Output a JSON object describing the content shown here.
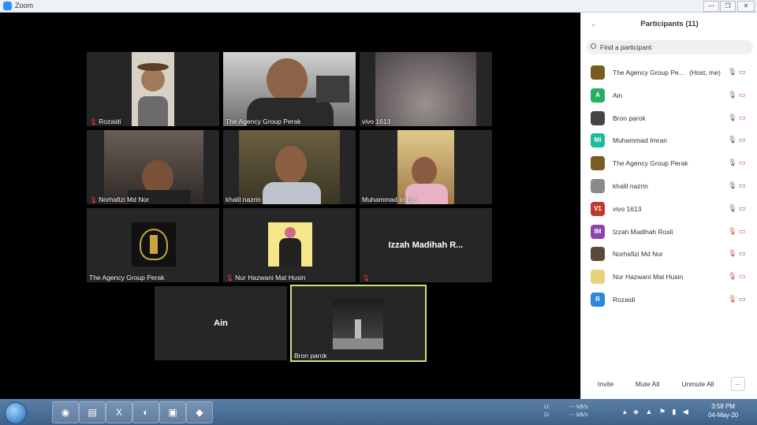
{
  "window": {
    "title": "Zoom",
    "min": "—",
    "max": "❐",
    "close": "✕"
  },
  "tiles": [
    {
      "name": "Rozaidi",
      "muted": true,
      "bg": "#2a2a2a",
      "content": "video"
    },
    {
      "name": "The Agency Group Perak",
      "muted": false,
      "bg": "#3a3a3a",
      "content": "video"
    },
    {
      "name": "vivo 1613",
      "muted": false,
      "bg": "#4a4444",
      "content": "video"
    },
    {
      "name": "Norhafizi Md Nor",
      "muted": true,
      "bg": "#3b3530",
      "content": "video"
    },
    {
      "name": "khalil nazrin",
      "muted": false,
      "bg": "#403a2a",
      "content": "video"
    },
    {
      "name": "Muhammad Imran",
      "muted": false,
      "bg": "#3b2f28",
      "content": "video"
    },
    {
      "name": "The Agency Group Perak",
      "muted": false,
      "bg": "#262626",
      "content": "logo"
    },
    {
      "name": "Nur Hazwani Mat Husin",
      "muted": true,
      "bg": "#262626",
      "content": "photo"
    },
    {
      "name": "",
      "muted": true,
      "bg": "#262626",
      "content": "text",
      "bigname": "Izzah Madihah R..."
    },
    {
      "name": "",
      "muted": false,
      "bg": "#262626",
      "content": "text",
      "bigname": "Ain"
    },
    {
      "name": "Bron parok",
      "muted": false,
      "bg": "#262626",
      "content": "photo",
      "active": true
    }
  ],
  "panel": {
    "chevron": "⌄",
    "title": "Participants (11)",
    "search_placeholder": "Find a participant",
    "participants": [
      {
        "name": "The Agency Group Pe...",
        "role": "(Host, me)",
        "avatar": "",
        "avatar_color": "#7a5c20",
        "mic_muted": false,
        "cam_off": false
      },
      {
        "name": "Ain",
        "role": "",
        "avatar": "A",
        "avatar_color": "#27ae60",
        "mic_muted": false,
        "cam_off": true
      },
      {
        "name": "Bron parok",
        "role": "",
        "avatar": "",
        "avatar_color": "#444444",
        "mic_muted": false,
        "cam_off": true
      },
      {
        "name": "Muhammad Imran",
        "role": "",
        "avatar": "MI",
        "avatar_color": "#1abc9c",
        "mic_muted": false,
        "cam_off": false
      },
      {
        "name": "The Agency Group Perak",
        "role": "",
        "avatar": "",
        "avatar_color": "#7a5c20",
        "mic_muted": false,
        "cam_off": true
      },
      {
        "name": "khalil nazrin",
        "role": "",
        "avatar": "",
        "avatar_color": "#8a8a8a",
        "mic_muted": false,
        "cam_off": false
      },
      {
        "name": "vivo 1613",
        "role": "",
        "avatar": "V1",
        "avatar_color": "#c0392b",
        "mic_muted": false,
        "cam_off": false
      },
      {
        "name": "Izzah Madihah Rosli",
        "role": "",
        "avatar": "IM",
        "avatar_color": "#8e44ad",
        "mic_muted": true,
        "cam_off": true
      },
      {
        "name": "Norhafizi Md Nor",
        "role": "",
        "avatar": "",
        "avatar_color": "#5a4a3a",
        "mic_muted": true,
        "cam_off": false
      },
      {
        "name": "Nur Hazwani Mat Husin",
        "role": "",
        "avatar": "",
        "avatar_color": "#e8d27a",
        "mic_muted": true,
        "cam_off": true
      },
      {
        "name": "Rozaidi",
        "role": "",
        "avatar": "R",
        "avatar_color": "#2e86de",
        "mic_muted": true,
        "cam_off": false
      }
    ],
    "footer": {
      "invite": "Invite",
      "mute_all": "Mute All",
      "unmute_all": "Unmute All",
      "more": "..."
    }
  },
  "taskbar": {
    "apps": [
      {
        "icon": "chrome-icon",
        "glyph": "◉"
      },
      {
        "icon": "folder-icon",
        "glyph": "▤"
      },
      {
        "icon": "excel-icon",
        "glyph": "X"
      },
      {
        "icon": "firefox-icon",
        "glyph": "◐"
      },
      {
        "icon": "zoom-icon",
        "glyph": "▣"
      },
      {
        "icon": "app-icon",
        "glyph": "◆"
      }
    ],
    "net_up_label": "U:",
    "net_up": "--- kB/s",
    "net_down_label": "D:",
    "net_down": "--- kB/s",
    "time": "3:58 PM",
    "date": "04-May-20"
  }
}
